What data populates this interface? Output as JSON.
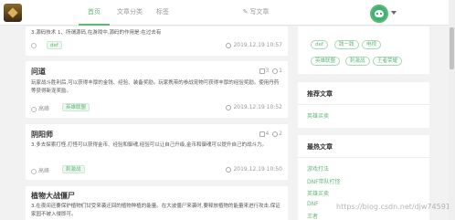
{
  "nav": {
    "home": "首页",
    "category": "文章分类",
    "tags": "标签",
    "write": "写文章"
  },
  "articles": [
    {
      "desc": "3.源码技术 1、所谓源码,在游戏中,源码的作用是:在过去有",
      "tag": "def",
      "date": "2019.12.19 10:57"
    },
    {
      "title": "问道",
      "desc": "玩家战斗胜利后,可以获得丰厚的金钱、经验、装备奖励。玩家携带的参战宠物可获得丰厚的经验奖励。使用丹药等获得新宠奖励。",
      "user": "高峰",
      "tag": "英雄联盟",
      "likes": "3",
      "comments": "1",
      "date": "2019.12.19 10:52"
    },
    {
      "title": "阴阳师",
      "desc": "3.多去探索打怪,打怪可以获得金币、经验和御魂,经验可以让自己升级,金币和御魂可以提升自己的战斗力。",
      "user": "高峰",
      "tag": "刺激战",
      "likes": "4",
      "comments": "2",
      "date": "2019.12.19 10:50"
    },
    {
      "title": "植物大战僵尸",
      "desc": "3.在夜间还要保护植物们甘受来袭迂回的植物种植的能量。在大波僵尸来袭时,要释放植物的能量来进行攻击,保证家园不被入侵即可。"
    }
  ],
  "sidebar": {
    "tags": [
      "def",
      "践一践",
      "电视",
      "英雄联盟",
      "刺激战",
      "王者荣耀"
    ],
    "recommended_title": "推荐文章",
    "recommended": [
      "英雄买卖"
    ],
    "hottest_title": "最热文章",
    "hottest": [
      "游戏打法",
      "DNF带队打怪",
      "英雄买卖",
      "DNF",
      "王者"
    ]
  },
  "watermark": "https://blog.csdn.net/djw745917"
}
